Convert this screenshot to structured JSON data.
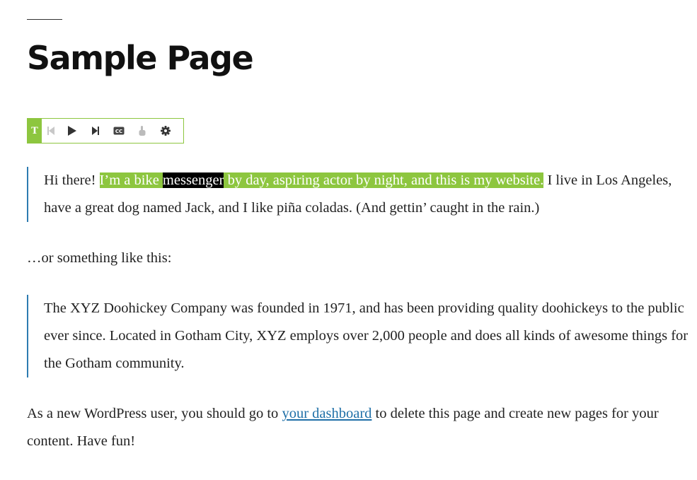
{
  "page": {
    "title": "Sample Page"
  },
  "tts_toolbar": {
    "logo_letter": "T",
    "accent_color": "#8dc63f",
    "buttons": [
      {
        "name": "skip-back-icon"
      },
      {
        "name": "play-icon"
      },
      {
        "name": "skip-forward-icon"
      },
      {
        "name": "closed-captions-icon"
      },
      {
        "name": "hand-pointer-icon"
      },
      {
        "name": "gear-icon"
      }
    ]
  },
  "quote1": {
    "before": "Hi there! ",
    "highlight_a": "I’m a bike ",
    "highlight_word": "messenger",
    "highlight_b": " by day, aspiring actor by night, and this is my website.",
    "after": " I live in Los Angeles, have a great dog named Jack, and I like piña coladas. (And gettin’ caught in the rain.)"
  },
  "middle_text": "…or something like this:",
  "quote2": {
    "text": "The XYZ Doohickey Company was founded in 1971, and has been providing quality doohickeys to the public ever since. Located in Gotham City, XYZ employs over 2,000 people and does all kinds of awesome things for the Gotham community."
  },
  "closing": {
    "before": "As a new WordPress user, you should go to ",
    "link_text": "your dashboard",
    "after": " to delete this page and create new pages for your content. Have fun!"
  },
  "colors": {
    "highlight_sentence": "#8dc63f",
    "highlight_word": "#000000",
    "quote_border": "#2d7bb0",
    "link": "#1e6fa7"
  }
}
